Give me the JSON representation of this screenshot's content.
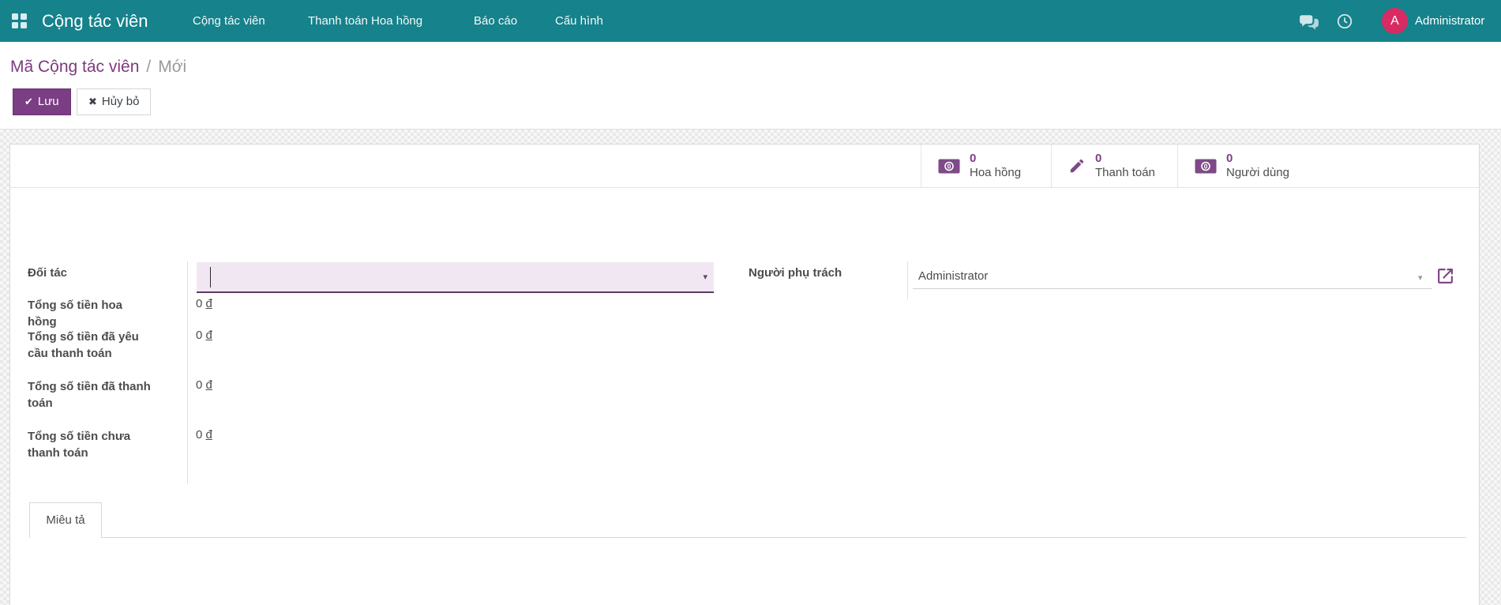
{
  "navbar": {
    "brand": "Cộng tác viên",
    "menu_items": [
      {
        "label": "Cộng tác viên"
      },
      {
        "label": "Thanh toán Hoa hồng"
      },
      {
        "label": "Báo cáo"
      },
      {
        "label": "Cấu hình"
      }
    ],
    "user": {
      "initial": "A",
      "name": "Administrator"
    }
  },
  "breadcrumb": {
    "parent": "Mã Cộng tác viên",
    "separator": "/",
    "current": "Mới"
  },
  "control_panel": {
    "save_label": "Lưu",
    "save_icon": "✔",
    "discard_label": "Hủy bỏ",
    "discard_icon": "✖"
  },
  "stat_buttons": [
    {
      "icon": "money-bill-icon",
      "value": "0",
      "label": "Hoa hồng"
    },
    {
      "icon": "pencil-icon",
      "value": "0",
      "label": "Thanh toán"
    },
    {
      "icon": "money-bill-icon",
      "value": "0",
      "label": "Người dùng"
    }
  ],
  "form": {
    "partner": {
      "label": "Đối tác",
      "value": "",
      "caret": "▾"
    },
    "manager": {
      "label": "Người phụ trách",
      "value": "Administrator",
      "caret": "▾"
    },
    "amount_rows": [
      {
        "label": "Tổng số tiền hoa hồng",
        "amount": "0",
        "currency": "đ"
      },
      {
        "label": "Tổng số tiền đã yêu cầu thanh toán",
        "amount": "0",
        "currency": "đ"
      },
      {
        "label": "Tổng số tiền đã thanh toán",
        "amount": "0",
        "currency": "đ"
      },
      {
        "label": "Tổng số tiền chưa thanh toán",
        "amount": "0",
        "currency": "đ"
      }
    ]
  },
  "notebook": {
    "tabs": [
      {
        "label": "Miêu tả",
        "active": true
      }
    ]
  },
  "colors": {
    "navbar_bg": "#15828C",
    "accent_purple": "#7D3F87",
    "avatar_bg": "#D92B63",
    "input_bg": "#F1E7F3",
    "input_border": "#5C3A64"
  }
}
